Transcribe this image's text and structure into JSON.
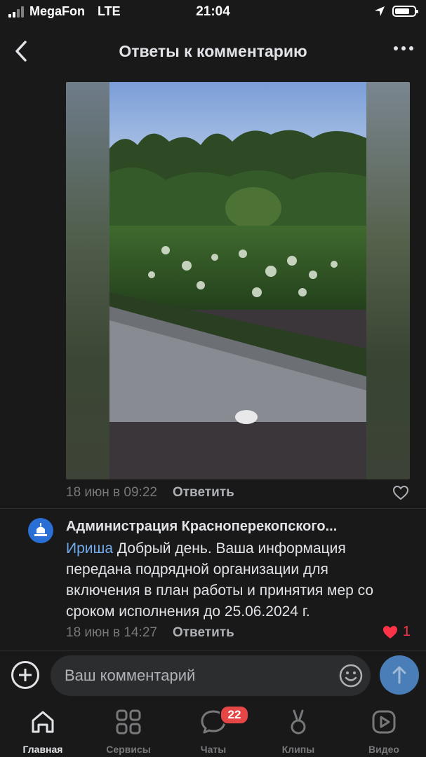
{
  "status_bar": {
    "carrier": "MegaFon",
    "network": "LTE",
    "time": "21:04"
  },
  "header": {
    "title": "Ответы к комментарию"
  },
  "photo_meta": {
    "date": "18 июн в 09:22",
    "reply_label": "Ответить"
  },
  "comment": {
    "author": "Администрация Краснoперекопского...",
    "mention": "Ириша",
    "text": " Добрый день. Ваша информация передана подрядной организации для включения в план работы и  принятия мер со сроком исполнения до 25.06.2024 г.",
    "date": "18 июн в 14:27",
    "reply_label": "Ответить",
    "likes": "1"
  },
  "input": {
    "placeholder": "Ваш комментарий"
  },
  "tabs": [
    {
      "label": "Главная",
      "icon": "home-icon",
      "active": true
    },
    {
      "label": "Сервисы",
      "icon": "services-icon"
    },
    {
      "label": "Чаты",
      "icon": "chat-icon",
      "badge": "22"
    },
    {
      "label": "Клипы",
      "icon": "clips-icon"
    },
    {
      "label": "Видео",
      "icon": "video-icon"
    }
  ],
  "colors": {
    "background": "#19191a",
    "accent": "#71aaeb",
    "like": "#ff3347",
    "badge": "#e64646",
    "send_button": "#4a7eb8"
  }
}
